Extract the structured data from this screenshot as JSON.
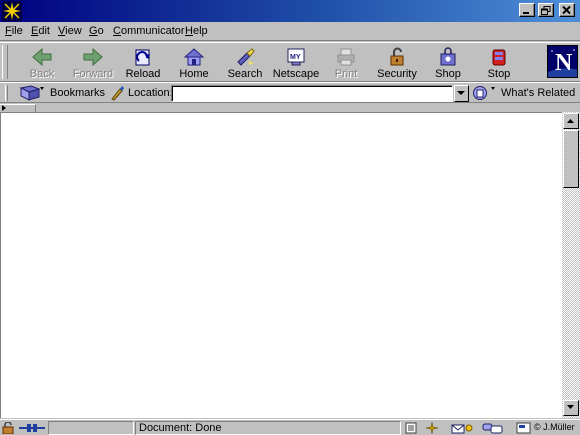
{
  "menubar": {
    "items": [
      {
        "label": "File",
        "accel": "F",
        "rest": "ile"
      },
      {
        "label": "Edit",
        "accel": "E",
        "rest": "dit"
      },
      {
        "label": "View",
        "accel": "V",
        "rest": "iew"
      },
      {
        "label": "Go",
        "accel": "G",
        "rest": "o"
      },
      {
        "label": "Communicator",
        "accel": "C",
        "rest": "ommunicator"
      },
      {
        "label": "Help",
        "accel": "H",
        "rest": "elp"
      }
    ]
  },
  "navigation_toolbar": {
    "back": "Back",
    "forward": "Forward",
    "reload": "Reload",
    "home": "Home",
    "search": "Search",
    "netscape": "Netscape",
    "print": "Print",
    "security": "Security",
    "shop": "Shop",
    "stop": "Stop"
  },
  "location_toolbar": {
    "bookmarks": "Bookmarks",
    "location_label": "Location:",
    "location_value": "",
    "whats_related": "What's Related"
  },
  "status_bar": {
    "message": "Document: Done",
    "credit": "© J.Müller"
  },
  "colors": {
    "titlebar_start": "#000080",
    "titlebar_end": "#4f8fd8",
    "chrome": "#c0c0c0",
    "content_bg": "#ffffff"
  }
}
